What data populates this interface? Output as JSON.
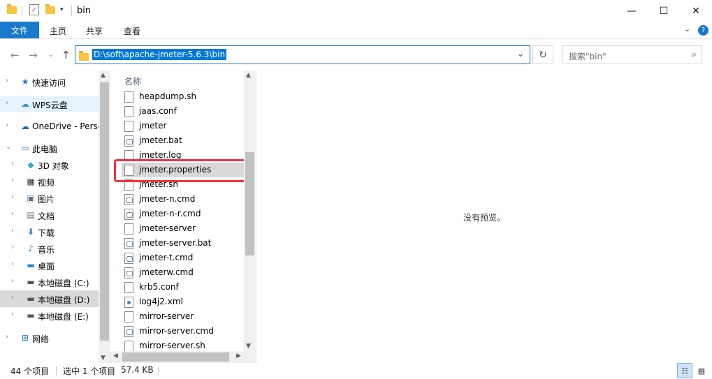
{
  "window": {
    "title": "bin",
    "minimize_glyph": "—",
    "maximize_glyph": "☐",
    "close_glyph": "✕"
  },
  "ribbon": {
    "tabs": [
      "文件",
      "主页",
      "共享",
      "查看"
    ],
    "expand_glyph": "⌄",
    "help_glyph": "?"
  },
  "address_bar": {
    "path": "D:\\soft\\apache-jmeter-5.6.3\\bin",
    "back_glyph": "←",
    "forward_glyph": "→",
    "recent_glyph": "⌄",
    "up_glyph": "↑",
    "dropdown_glyph": "⌄",
    "refresh_glyph": "↻"
  },
  "search": {
    "placeholder": "搜索\"bin\"",
    "icon": "search-icon"
  },
  "navigation": {
    "items": [
      {
        "label": "快速访问",
        "icon": "star-icon",
        "glyph": "★",
        "color": "#1e78d6",
        "chevron": "›"
      },
      {
        "label": "WPS云盘",
        "icon": "cloud-icon",
        "glyph": "☁",
        "color": "#3a8ee6",
        "chevron": "›"
      },
      {
        "label": "OneDrive - Personal",
        "icon": "cloud-icon",
        "glyph": "☁",
        "color": "#1a6fd0",
        "chevron": "›"
      },
      {
        "label": "此电脑",
        "icon": "computer-icon",
        "glyph": "▭",
        "color": "#3f8bd6",
        "chevron": "⌄"
      },
      {
        "label": "3D 对象",
        "icon": "cube-icon",
        "glyph": "◆",
        "color": "#2aa6d6",
        "chevron": "›"
      },
      {
        "label": "视频",
        "icon": "film-icon",
        "glyph": "▦",
        "color": "#333333",
        "chevron": "›"
      },
      {
        "label": "图片",
        "icon": "picture-icon",
        "glyph": "▣",
        "color": "#5b6f88",
        "chevron": "›"
      },
      {
        "label": "文档",
        "icon": "document-icon",
        "glyph": "▤",
        "color": "#6a7a8c",
        "chevron": "›"
      },
      {
        "label": "下载",
        "icon": "download-icon",
        "glyph": "⬇",
        "color": "#2a7fd4",
        "chevron": "›"
      },
      {
        "label": "音乐",
        "icon": "music-icon",
        "glyph": "♪",
        "color": "#2a7fd4",
        "chevron": "›"
      },
      {
        "label": "桌面",
        "icon": "desktop-icon",
        "glyph": "▬",
        "color": "#2a86d8",
        "chevron": "›"
      },
      {
        "label": "本地磁盘 (C:)",
        "icon": "drive-icon",
        "glyph": "▬",
        "color": "#555555",
        "chevron": "›"
      },
      {
        "label": "本地磁盘 (D:)",
        "icon": "drive-icon",
        "glyph": "▬",
        "color": "#555555",
        "chevron": "›"
      },
      {
        "label": "本地磁盘 (E:)",
        "icon": "drive-icon",
        "glyph": "▬",
        "color": "#555555",
        "chevron": "›"
      },
      {
        "label": "网络",
        "icon": "network-icon",
        "glyph": "⊞",
        "color": "#2a7fd4",
        "chevron": "›"
      }
    ],
    "selected_index": 12
  },
  "file_list": {
    "column_header": "名称",
    "sort_glyph": "^",
    "files": [
      {
        "name": "heapdump.sh",
        "type": "plain"
      },
      {
        "name": "jaas.conf",
        "type": "plain"
      },
      {
        "name": "jmeter",
        "type": "plain"
      },
      {
        "name": "jmeter.bat",
        "type": "bat"
      },
      {
        "name": "jmeter.log",
        "type": "plain"
      },
      {
        "name": "jmeter.properties",
        "type": "plain"
      },
      {
        "name": "jmeter.sh",
        "type": "plain"
      },
      {
        "name": "jmeter-n.cmd",
        "type": "bat"
      },
      {
        "name": "jmeter-n-r.cmd",
        "type": "bat"
      },
      {
        "name": "jmeter-server",
        "type": "plain"
      },
      {
        "name": "jmeter-server.bat",
        "type": "bat"
      },
      {
        "name": "jmeter-t.cmd",
        "type": "bat"
      },
      {
        "name": "jmeterw.cmd",
        "type": "bat"
      },
      {
        "name": "krb5.conf",
        "type": "plain"
      },
      {
        "name": "log4j2.xml",
        "type": "xml"
      },
      {
        "name": "mirror-server",
        "type": "plain"
      },
      {
        "name": "mirror-server.cmd",
        "type": "bat"
      },
      {
        "name": "mirror-server.sh",
        "type": "plain"
      }
    ],
    "selected_index": 5,
    "highlight_color": "#f3343b"
  },
  "preview": {
    "message": "没有预览。"
  },
  "status_bar": {
    "item_count": "44 个项目",
    "selection": "选中 1 个项目",
    "size": "57.4 KB",
    "details_view_icon": "details-view-icon",
    "details_glyph": "☷",
    "thumbnail_view_icon": "large-icons-view-icon",
    "thumbnail_glyph": "▦"
  },
  "colors": {
    "accent": "#1979ca",
    "selection_blue": "#0078d7"
  }
}
